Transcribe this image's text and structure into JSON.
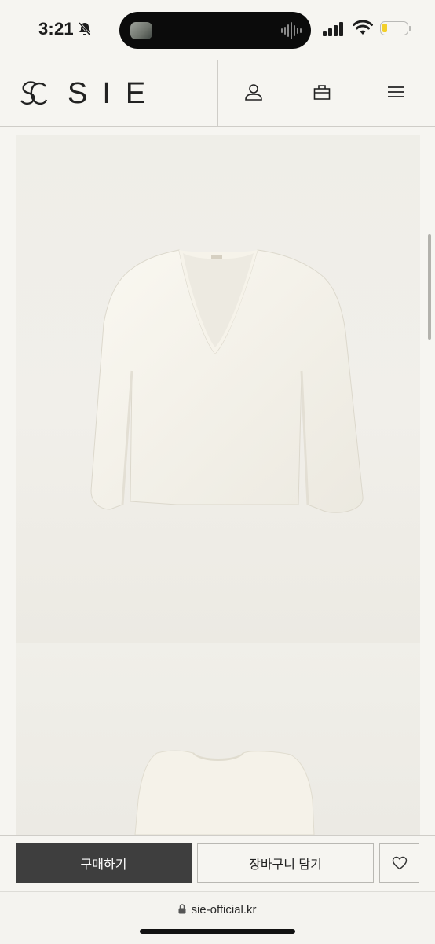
{
  "status_bar": {
    "time": "3:21"
  },
  "header": {
    "brand": "SIE",
    "icons": [
      "user-icon",
      "shopping-bag-icon",
      "hamburger-menu-icon"
    ]
  },
  "product": {
    "images": [
      "sweater-front-photo",
      "sweater-second-photo"
    ]
  },
  "actions": {
    "buy_label": "구매하기",
    "cart_label": "장바구니 담기",
    "wishlist_icon": "heart-icon"
  },
  "browser": {
    "url": "sie-official.kr"
  },
  "colors": {
    "buy_button": "#3e3e3e",
    "background": "#f6f5f1",
    "battery": "#f3cf2a"
  }
}
